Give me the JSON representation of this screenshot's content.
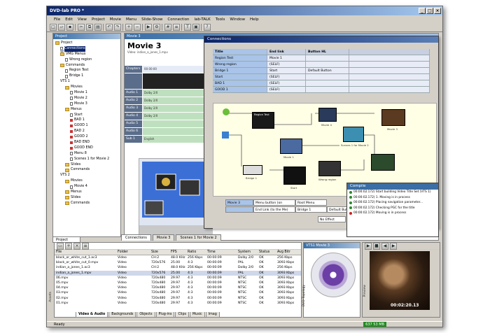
{
  "app": {
    "title": "DVD-lab PRO *"
  },
  "menu": [
    "File",
    "Edit",
    "View",
    "Project",
    "Movie",
    "Menu",
    "Slide-Show",
    "Connection",
    "lab-TALK",
    "Tools",
    "Window",
    "Help"
  ],
  "project": {
    "header": "Project",
    "tab": "Project",
    "tree": [
      {
        "label": "Project",
        "depth": 0,
        "icon": "folder"
      },
      {
        "label": "Connections",
        "depth": 1,
        "icon": "doc"
      },
      {
        "label": "VMG Menus",
        "depth": 1,
        "icon": "folder"
      },
      {
        "label": "Wrong region",
        "depth": 2,
        "icon": "doc"
      },
      {
        "label": "Commands",
        "depth": 1,
        "icon": "folder"
      },
      {
        "label": "Region Test",
        "depth": 2,
        "icon": "doc"
      },
      {
        "label": "Bridge 1",
        "depth": 2,
        "icon": "doc"
      },
      {
        "label": "VTS 1",
        "depth": 1,
        "icon": "disc"
      },
      {
        "label": "Movies",
        "depth": 2,
        "icon": "folder"
      },
      {
        "label": "Movie 1",
        "depth": 3,
        "icon": "doc"
      },
      {
        "label": "Movie 2",
        "depth": 3,
        "icon": "doc"
      },
      {
        "label": "Movie 3",
        "depth": 3,
        "icon": "doc"
      },
      {
        "label": "Menus",
        "depth": 2,
        "icon": "folder"
      },
      {
        "label": "Start",
        "depth": 3,
        "icon": "doc"
      },
      {
        "label": "BAD 1",
        "depth": 3,
        "icon": "flag"
      },
      {
        "label": "GOOD 1",
        "depth": 3,
        "icon": "flag"
      },
      {
        "label": "BAD 2",
        "depth": 3,
        "icon": "flag"
      },
      {
        "label": "GOOD 2",
        "depth": 3,
        "icon": "flag"
      },
      {
        "label": "BAD END",
        "depth": 3,
        "icon": "flag"
      },
      {
        "label": "GOOD END",
        "depth": 3,
        "icon": "flag"
      },
      {
        "label": "Menu 8",
        "depth": 3,
        "icon": "doc"
      },
      {
        "label": "Scenes 1 for Movie 2",
        "depth": 3,
        "icon": "doc"
      },
      {
        "label": "Slides",
        "depth": 2,
        "icon": "folder"
      },
      {
        "label": "Commands",
        "depth": 2,
        "icon": "folder"
      },
      {
        "label": "VTS 2",
        "depth": 1,
        "icon": "disc"
      },
      {
        "label": "Movies",
        "depth": 2,
        "icon": "folder"
      },
      {
        "label": "Movie 4",
        "depth": 3,
        "icon": "doc"
      },
      {
        "label": "Menus",
        "depth": 2,
        "icon": "folder"
      },
      {
        "label": "Slides",
        "depth": 2,
        "icon": "folder"
      },
      {
        "label": "Commands",
        "depth": 2,
        "icon": "folder"
      }
    ]
  },
  "movie": {
    "window_title": "Movie 3",
    "title": "Movie 3",
    "subtitle": "Video: indian_a_jones_1.mpv",
    "track_labels": [
      "Chapters",
      "",
      "Audio 1",
      "Audio 2",
      "Audio 3",
      "Audio 4",
      "Audio 5",
      "Audio 6",
      "Sub 1"
    ],
    "tracks": [
      "00:00:00",
      "",
      "Dolby 2/0",
      "Dolby 2/0",
      "Dolby 2/0",
      "Dolby 2/0",
      "",
      "",
      "English"
    ]
  },
  "connections": {
    "title": "Connections",
    "columns": [
      "Title",
      "End link",
      "Button HL"
    ],
    "rows": [
      [
        "Region Test",
        "Movie 1",
        ""
      ],
      [
        "Wrong region",
        "(SELF)",
        ""
      ],
      [
        "Bridge 1",
        "Start",
        "Default Button"
      ],
      [
        "Start",
        "(SELF)",
        ""
      ],
      [
        "BAD 1",
        "(SELF)",
        ""
      ],
      [
        "GOOD 1",
        "(SELF)",
        ""
      ]
    ],
    "nodes": {
      "first_play": "First Play",
      "title_button": "Title Button",
      "region_test": "Region Test",
      "movie1": "Movie 1",
      "movie4": "Movie 4",
      "scenes": "Scenes 1 for Movie 2",
      "movie3": "Movie 3",
      "bridge": "Bridge 1",
      "start": "Start",
      "wrong": "Wrong region"
    },
    "watermark": "© PRO. BETA vers",
    "bottom": {
      "label1": "Movie 3",
      "cell1": "Menu button (on remote)",
      "cell2": "Root Menu",
      "label2": "End Link (to the Me)",
      "cell3": "Bridge 1",
      "cell4": "Default Butt...",
      "no_effect": "No Effect"
    }
  },
  "console": {
    "title": "Compile",
    "lines": [
      {
        "text": "00:00:02.172) Start building Video Title Set (VTS 1)",
        "color": "#2a8a2a"
      },
      {
        "text": "00:00:02.172) 1. Moving is in process",
        "color": "#2a8a2a"
      },
      {
        "text": "00:00:02.172) Placing navigation parameter...",
        "color": "#2a8a2a"
      },
      {
        "text": "00:00:02.172) Checking PGC for the title",
        "color": "#2a8a2a"
      },
      {
        "text": "00:00:02.172) Moving is in process",
        "color": "#cc2222"
      }
    ]
  },
  "bottom_tabs": [
    "Connections",
    "Movie 3",
    "Scenes 1 for Movie 2"
  ],
  "assets": {
    "columns": [
      "File",
      "Folder",
      "Size",
      "FPS",
      "Ratio",
      "Time",
      "System",
      "Status",
      "Avg Bitr"
    ],
    "rows": [
      [
        "black_or_white_cut_1.ac3",
        "Video",
        "CH:2",
        "48.0 KHz",
        "256 Kbps",
        "00:00:09",
        "Dolby 2/0",
        "OK",
        "256 Kbps"
      ],
      [
        "black_or_white_cut_0.mpv",
        "Video",
        "720x576",
        "25.00",
        "4:3",
        "00:00:09",
        "PAL",
        "OK",
        "3093 Kbps"
      ],
      [
        "indian_a_jones_1.ac3",
        "Video",
        "CH:2",
        "48.0 KHz",
        "256 Kbps",
        "00:00:09",
        "Dolby 2/0",
        "OK",
        "256 Kbps"
      ],
      [
        "indian_a_jones_1.mpv",
        "Video",
        "720x576",
        "25.00",
        "4:3",
        "00:00:09",
        "PAL",
        "OK",
        "3093 Kbps"
      ],
      [
        "06.mpv",
        "Video",
        "720x480",
        "29.97",
        "4:3",
        "00:00:09",
        "NTSC",
        "OK",
        "3093 Kbps"
      ],
      [
        "05.mpv",
        "Video",
        "720x480",
        "29.97",
        "4:3",
        "00:00:09",
        "NTSC",
        "OK",
        "3093 Kbps"
      ],
      [
        "04.mpv",
        "Video",
        "720x480",
        "29.97",
        "4:3",
        "00:00:09",
        "NTSC",
        "OK",
        "3093 Kbps"
      ],
      [
        "03.mpv",
        "Video",
        "720x480",
        "29.97",
        "4:3",
        "00:00:09",
        "NTSC",
        "OK",
        "3093 Kbps"
      ],
      [
        "02.mpv",
        "Video",
        "720x480",
        "29.97",
        "4:3",
        "00:00:09",
        "NTSC",
        "OK",
        "3093 Kbps"
      ],
      [
        "01.mpv",
        "Video",
        "720x480",
        "29.97",
        "4:3",
        "00:00:09",
        "NTSC",
        "OK",
        "3093 Kbps"
      ]
    ],
    "tabs": [
      "Video & Audio",
      "Backgrounds",
      "Objects",
      "Plug-ins",
      "Clips",
      "Music",
      "Imag"
    ],
    "side_label": "Assets"
  },
  "vts": {
    "title": "VTS1 Movie 3",
    "side_label": "DVD Topology"
  },
  "preview": {
    "timecode": "00:02:20.13",
    "side_label": "Preview"
  },
  "status": {
    "left": "Ready",
    "right": "637 53 MB"
  }
}
